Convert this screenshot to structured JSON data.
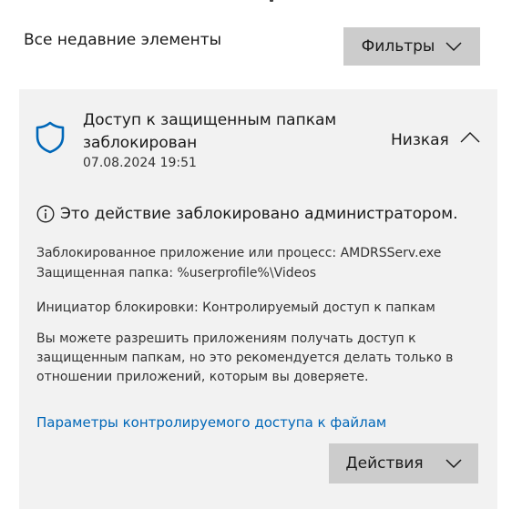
{
  "header": {
    "title": "Все недавние элементы",
    "filter_label": "Фильтры"
  },
  "card": {
    "icon": "shield-icon",
    "title": "Доступ к защищенным папкам заблокирован",
    "date": "07.08.2024 19:51",
    "severity": "Низкая",
    "blocked_message": "Это действие заблокировано администратором.",
    "app_line": "Заблокированное приложение или процесс:  AMDRSServ.exe",
    "folder_line": "Защищенная папка:  %userprofile%\\Videos",
    "initiator_line": "Инициатор блокировки:  Контролируемый доступ к папкам",
    "description": "Вы можете разрешить приложениям получать доступ к защищенным папкам, но это рекомендуется делать только в отношении приложений, которым вы доверяете.",
    "settings_link": "Параметры контролируемого доступа к файлам",
    "actions_label": "Действия"
  },
  "colors": {
    "accent": "#0067b8",
    "card_bg": "#f2f2f2",
    "button_bg": "#cccccc"
  }
}
